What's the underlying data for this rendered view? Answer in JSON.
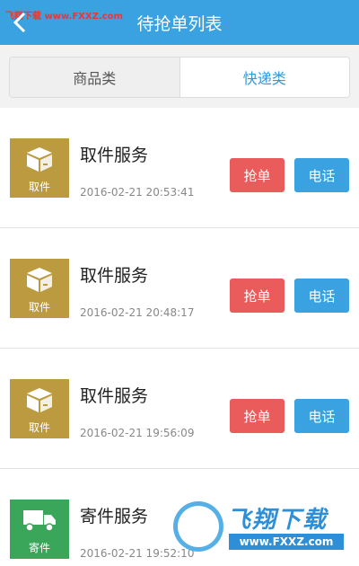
{
  "header": {
    "title": "待抢单列表",
    "watermark": "飞翔下载 www.FXXZ.com"
  },
  "tabs": [
    {
      "label": "商品类",
      "active": false
    },
    {
      "label": "快递类",
      "active": true
    }
  ],
  "items": [
    {
      "name": "取件服务",
      "time": "2016-02-21 20:53:41",
      "icon_label": "取件",
      "icon": "box-icon",
      "grab_label": "抢单",
      "call_label": "电话"
    },
    {
      "name": "取件服务",
      "time": "2016-02-21 20:48:17",
      "icon_label": "取件",
      "icon": "box-icon",
      "grab_label": "抢单",
      "call_label": "电话"
    },
    {
      "name": "取件服务",
      "time": "2016-02-21 19:56:09",
      "icon_label": "取件",
      "icon": "box-icon",
      "grab_label": "抢单",
      "call_label": "电话"
    },
    {
      "name": "寄件服务",
      "time": "2016-02-21 19:52:10",
      "icon_label": "寄件",
      "icon": "truck-icon"
    }
  ],
  "watermark": {
    "brand": "飞翔下载",
    "url": "www.FXXZ.com"
  },
  "colors": {
    "header": "#3aa2e0",
    "grab": "#ea5b5b",
    "call": "#3aa2e0",
    "pickup_icon": "#bb9a40",
    "send_icon": "#3aa65a"
  }
}
